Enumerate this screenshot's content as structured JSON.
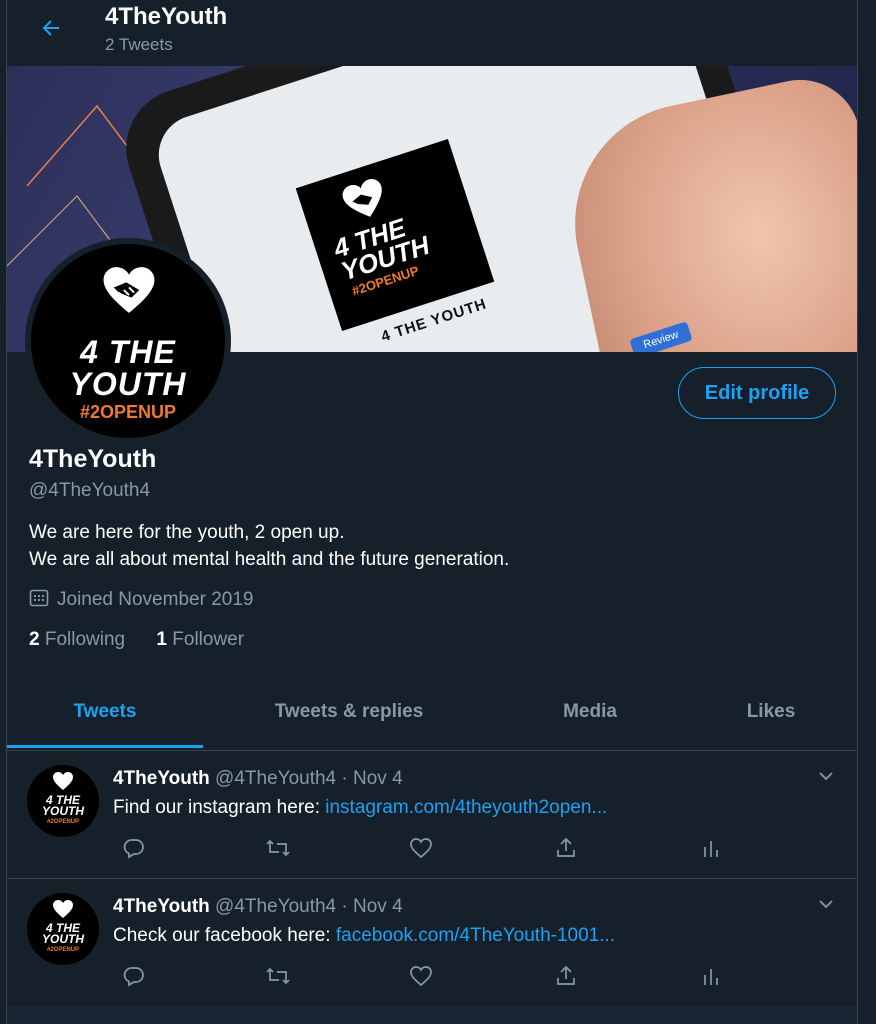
{
  "header": {
    "title": "4TheYouth",
    "subtitle": "2 Tweets"
  },
  "banner": {
    "logo_line1": "4 THE",
    "logo_line2": "YOUTH",
    "logo_tag": "#2OPENUP",
    "caption": "4 THE YOUTH",
    "review": "Review"
  },
  "avatar": {
    "line1": "4 THE",
    "line2": "YOUTH",
    "tag": "#2OPENUP"
  },
  "profile": {
    "edit_label": "Edit profile",
    "name": "4TheYouth",
    "handle": "@4TheYouth4",
    "bio_line1": "We are here for the youth, 2 open up.",
    "bio_line2": "We are all about mental health and the future generation.",
    "joined": "Joined November 2019",
    "following_count": "2",
    "following_label": "Following",
    "followers_count": "1",
    "followers_label": "Follower"
  },
  "tabs": [
    {
      "label": "Tweets"
    },
    {
      "label": "Tweets & replies"
    },
    {
      "label": "Media"
    },
    {
      "label": "Likes"
    }
  ],
  "tweets": [
    {
      "name": "4TheYouth",
      "meta": "@4TheYouth4 · Nov 4",
      "text": "Find our instagram here: ",
      "link": "instagram.com/4theyouth2open..."
    },
    {
      "name": "4TheYouth",
      "meta": "@4TheYouth4 · Nov 4",
      "text": "Check our facebook here: ",
      "link": "facebook.com/4TheYouth-1001..."
    }
  ],
  "colors": {
    "background": "#15202b",
    "accent": "#1da1f2",
    "muted": "#8899a6",
    "border": "#38444d",
    "tag_orange": "#f07a2e"
  }
}
